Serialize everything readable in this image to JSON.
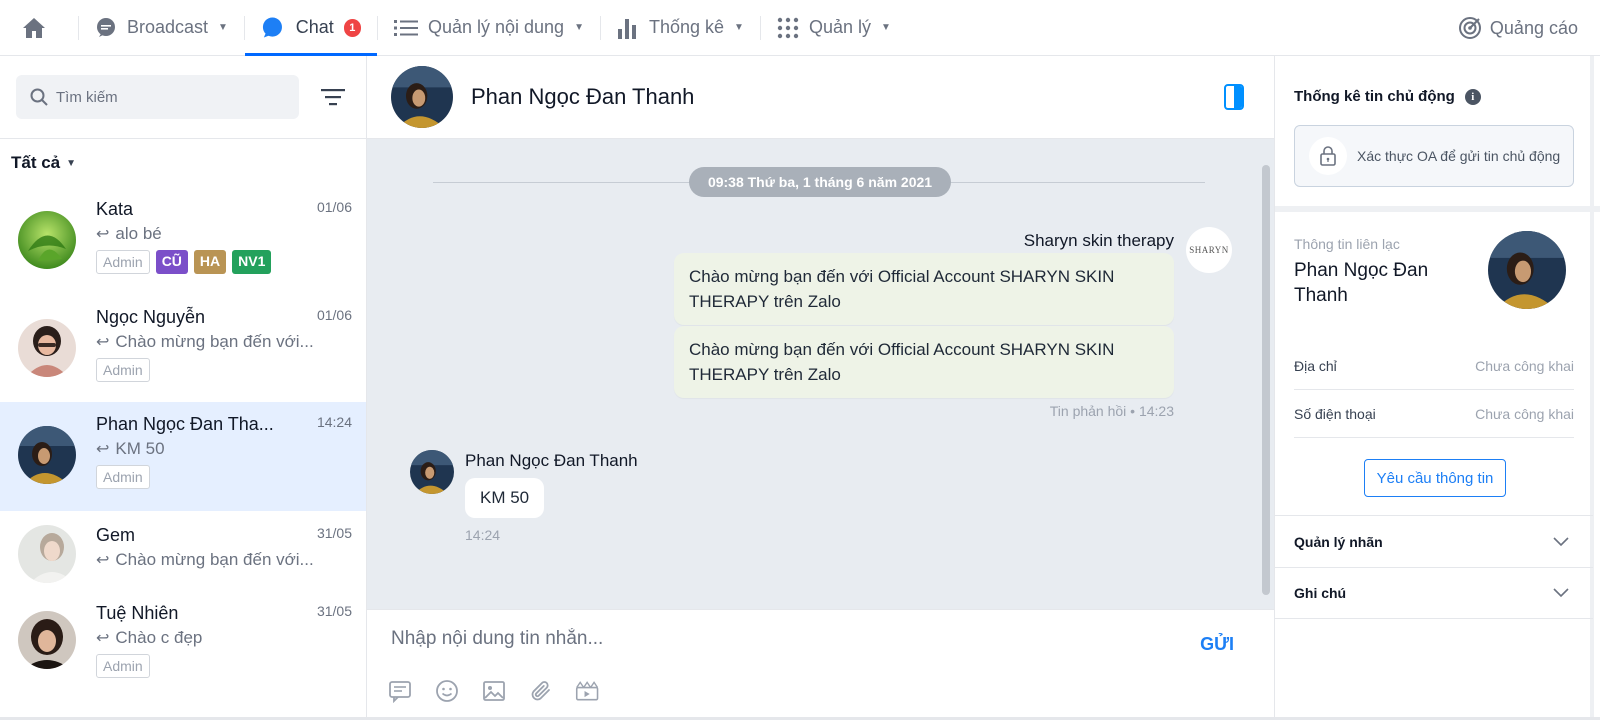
{
  "nav": {
    "broadcast": "Broadcast",
    "chat": "Chat",
    "chat_badge": "1",
    "content": "Quản lý nội dung",
    "stats": "Thống kê",
    "manage": "Quản lý",
    "ads": "Quảng cáo"
  },
  "sidebar": {
    "search_placeholder": "Tìm kiếm",
    "filter": "Tất cả",
    "conversations": [
      {
        "name": "Kata",
        "time": "01/06",
        "msg": "alo bé",
        "tags": [
          "Admin",
          "CŨ",
          "HA",
          "NV1"
        ]
      },
      {
        "name": "Ngọc Nguyễn",
        "time": "01/06",
        "msg": "Chào mừng bạn đến với...",
        "tags": [
          "Admin"
        ]
      },
      {
        "name": "Phan Ngọc Đan Tha...",
        "time": "14:24",
        "msg": "KM 50",
        "tags": [
          "Admin"
        ]
      },
      {
        "name": "Gem",
        "time": "31/05",
        "msg": "Chào mừng bạn đến với...",
        "tags": []
      },
      {
        "name": "Tuệ Nhiên",
        "time": "31/05",
        "msg": "Chào c đẹp",
        "tags": [
          "Admin"
        ]
      }
    ]
  },
  "chat": {
    "title": "Phan Ngọc Đan Thanh",
    "date": "09:38 Thứ ba, 1 tháng 6 năm 2021",
    "oa_name": "Sharyn skin therapy",
    "oa_avatar_text": "SHARYN",
    "outgoing": [
      "Chào mừng bạn đến với Official Account SHARYN SKIN THERAPY trên Zalo",
      "Chào mừng bạn đến với Official Account SHARYN SKIN THERAPY trên Zalo"
    ],
    "out_meta": "Tin phản hồi • 14:23",
    "incoming_name": "Phan Ngọc Đan Thanh",
    "incoming_msg": "KM 50",
    "incoming_time": "14:24",
    "input_placeholder": "Nhập nội dung tin nhắn...",
    "send": "GỬI"
  },
  "right": {
    "stats_title": "Thống kê tin chủ động",
    "info_icon": "i",
    "verify_text": "Xác thực OA để gửi tin chủ động",
    "contact_label": "Thông tin liên lạc",
    "contact_name": "Phan Ngọc Đan Thanh",
    "address_label": "Địa chỉ",
    "address_value": "Chưa công khai",
    "phone_label": "Số điện thoại",
    "phone_value": "Chưa công khai",
    "request_btn": "Yêu cầu thông tin",
    "tags_section": "Quản lý nhãn",
    "notes_section": "Ghi chú"
  }
}
